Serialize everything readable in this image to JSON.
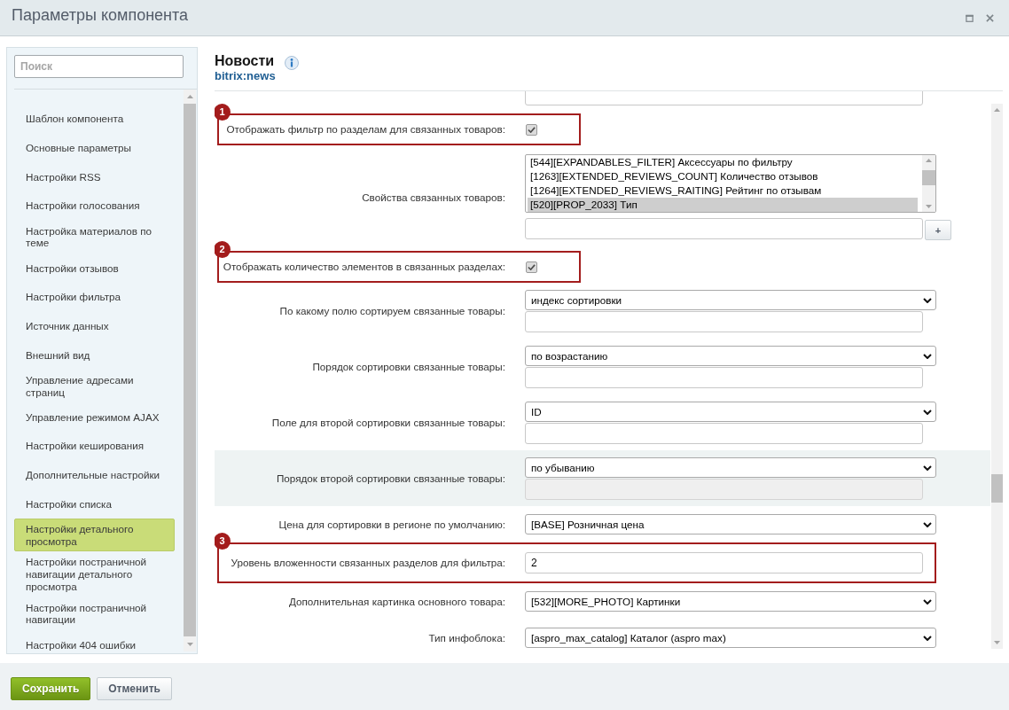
{
  "window": {
    "title": "Параметры компонента",
    "controls": [
      {
        "kind": "maximize"
      },
      {
        "kind": "close"
      }
    ]
  },
  "sidebar": {
    "search": {
      "placeholder": "Поиск"
    },
    "items": [
      {
        "label": "Шаблон компонента",
        "selected": false
      },
      {
        "label": "Основные параметры",
        "selected": false
      },
      {
        "label": "Настройки RSS",
        "selected": false
      },
      {
        "label": "Настройки голосования",
        "selected": false
      },
      {
        "label": "Настройка материалов по теме",
        "selected": false
      },
      {
        "label": "Настройки отзывов",
        "selected": false
      },
      {
        "label": "Настройки фильтра",
        "selected": false
      },
      {
        "label": "Источник данных",
        "selected": false
      },
      {
        "label": "Внешний вид",
        "selected": false
      },
      {
        "label": "Управление адресами страниц",
        "selected": false
      },
      {
        "label": "Управление режимом AJAX",
        "selected": false
      },
      {
        "label": "Настройки кеширования",
        "selected": false
      },
      {
        "label": "Дополнительные настройки",
        "selected": false
      },
      {
        "label": "Настройки списка",
        "selected": false
      },
      {
        "label": "Настройки детального просмотра",
        "selected": true
      },
      {
        "label": "Настройки постраничной навигации детального просмотра",
        "selected": false
      },
      {
        "label": "Настройки постраничной навигации",
        "selected": false
      },
      {
        "label": "Настройки 404 ошибки",
        "selected": false
      }
    ]
  },
  "component": {
    "title": "Новости",
    "code": "bitrix:news"
  },
  "settings": [
    {
      "highlighted": false,
      "controls": [
        {
          "kind": "input",
          "disabled": false
        }
      ]
    },
    {
      "label": "Отображать фильтр по разделам для связанных товаров:",
      "callout": "1",
      "highlighted": false,
      "controls": [
        {
          "kind": "checkbox",
          "checked": true
        }
      ]
    },
    {
      "label": "Свойства связанных товаров:",
      "highlighted": false,
      "controls": [
        {
          "kind": "listbox",
          "options": [
            {
              "label": "[544][EXPANDABLES_FILTER] Аксессуары по фильтру",
              "selected": false
            },
            {
              "label": "[1263][EXTENDED_REVIEWS_COUNT] Количество отзывов",
              "selected": false
            },
            {
              "label": "[1264][EXTENDED_REVIEWS_RAITING] Рейтинг по отзывам",
              "selected": false
            },
            {
              "label": "[520][PROP_2033] Тип",
              "selected": true
            }
          ]
        },
        {
          "kind": "input",
          "disabled": false,
          "button": "+"
        }
      ]
    },
    {
      "label": "Отображать количество элементов в связанных разделах:",
      "callout": "2",
      "highlighted": false,
      "controls": [
        {
          "kind": "checkbox",
          "checked": true
        }
      ]
    },
    {
      "label": "По какому полю сортируем связанные товары:",
      "highlighted": false,
      "controls": [
        {
          "kind": "select",
          "value": "индекс сортировки"
        },
        {
          "kind": "input",
          "disabled": false
        }
      ]
    },
    {
      "label": "Порядок сортировки связанные товары:",
      "highlighted": false,
      "controls": [
        {
          "kind": "select",
          "value": "по возрастанию"
        },
        {
          "kind": "input",
          "disabled": false
        }
      ]
    },
    {
      "label": "Поле для второй сортировки связанные товары:",
      "highlighted": false,
      "controls": [
        {
          "kind": "select",
          "value": "ID"
        },
        {
          "kind": "input",
          "disabled": false
        }
      ]
    },
    {
      "label": "Порядок второй сортировки связанные товары:",
      "highlighted": true,
      "controls": [
        {
          "kind": "select",
          "value": "по убыванию"
        },
        {
          "kind": "input",
          "disabled": true
        }
      ]
    },
    {
      "label": "Цена для сортировки в регионе по умолчанию:",
      "highlighted": false,
      "controls": [
        {
          "kind": "select",
          "value": "[BASE] Розничная цена"
        }
      ]
    },
    {
      "label": "Уровень вложенности связанных разделов для фильтра:",
      "callout": "3",
      "highlighted": false,
      "controls": [
        {
          "kind": "input",
          "value": "2",
          "disabled": false
        }
      ]
    },
    {
      "label": "Дополнительная картинка основного товара:",
      "highlighted": false,
      "controls": [
        {
          "kind": "select",
          "value": "[532][MORE_PHOTO] Картинки"
        }
      ]
    },
    {
      "label": "Тип инфоблока:",
      "highlighted": false,
      "controls": [
        {
          "kind": "select",
          "value": "[aspro_max_catalog] Каталог (aspro max)"
        }
      ]
    }
  ],
  "buttons": [
    {
      "label": "Сохранить",
      "kind": "primary"
    },
    {
      "label": "Отменить",
      "kind": "secondary"
    }
  ]
}
